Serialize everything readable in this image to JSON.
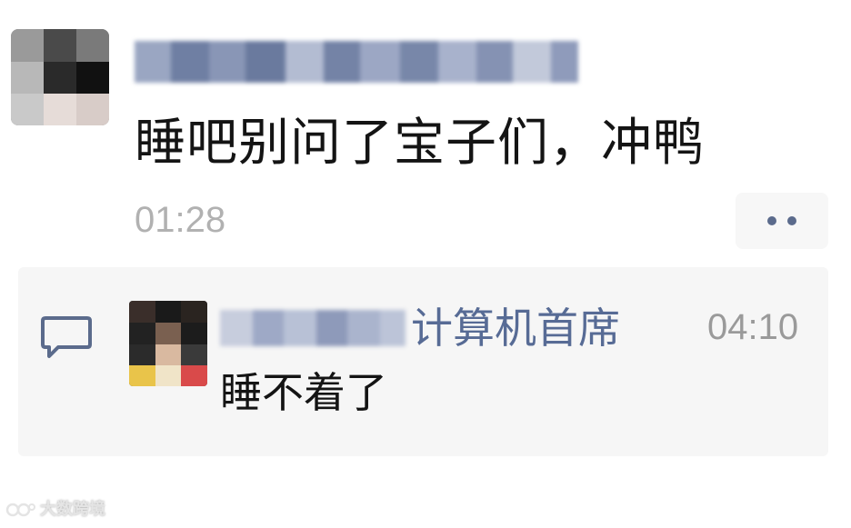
{
  "post": {
    "content": "睡吧别问了宝子们，冲鸭",
    "time": "01:28",
    "avatar_icon": "user-avatar-icon",
    "more_icon": "more-dots-icon"
  },
  "comment": {
    "author_visible": "计算机首席",
    "time": "04:10",
    "content": "睡不着了",
    "icon": "comment-bubble-icon",
    "name_color": "#576b95"
  },
  "watermark": {
    "text": "大数跨境"
  },
  "colors": {
    "background": "#ffffff",
    "panel": "#f6f6f6",
    "link_blue": "#576b95",
    "time_gray": "#b1b1b1"
  }
}
